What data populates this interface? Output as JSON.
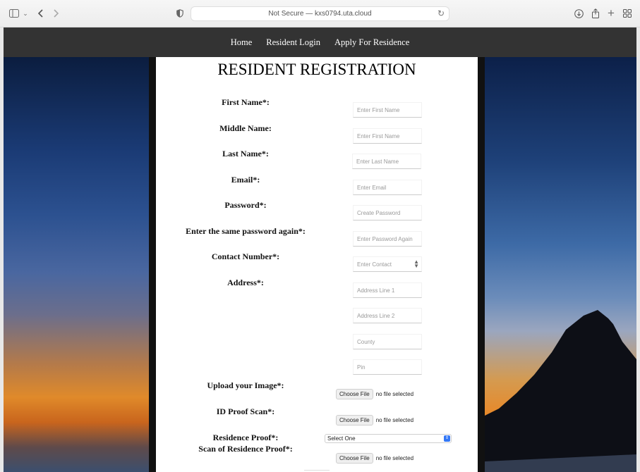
{
  "browser": {
    "url_text": "Not Secure — kxs0794.uta.cloud"
  },
  "nav": {
    "items": [
      "Home",
      "Resident Login",
      "Apply For Residence"
    ]
  },
  "form": {
    "title": "RESIDENT REGISTRATION",
    "labels": {
      "first_name": "First Name*:",
      "middle_name": "Middle Name:",
      "last_name": "Last Name*:",
      "email": "Email*:",
      "password": "Password*:",
      "password_again": "Enter the same password again*:",
      "contact": "Contact Number*:",
      "address": "Address*:",
      "upload_image": "Upload your Image*:",
      "id_proof": "ID Proof Scan*:",
      "residence_proof": "Residence Proof*:",
      "scan_residence_proof": "Scan of Residence Proof*:"
    },
    "placeholders": {
      "first_name": "Enter First Name",
      "middle_name": "Enter First Name",
      "last_name": "Enter Last Name",
      "email": "Enter Email",
      "password": "Create Password",
      "password_again": "Enter Password Again",
      "contact": "Enter Contact",
      "address1": "Address Line 1",
      "address2": "Address Line 2",
      "county": "County",
      "pin": "Pin"
    },
    "file": {
      "button": "Choose File",
      "status": "no file selected"
    },
    "select": {
      "selected": "Select One"
    }
  }
}
